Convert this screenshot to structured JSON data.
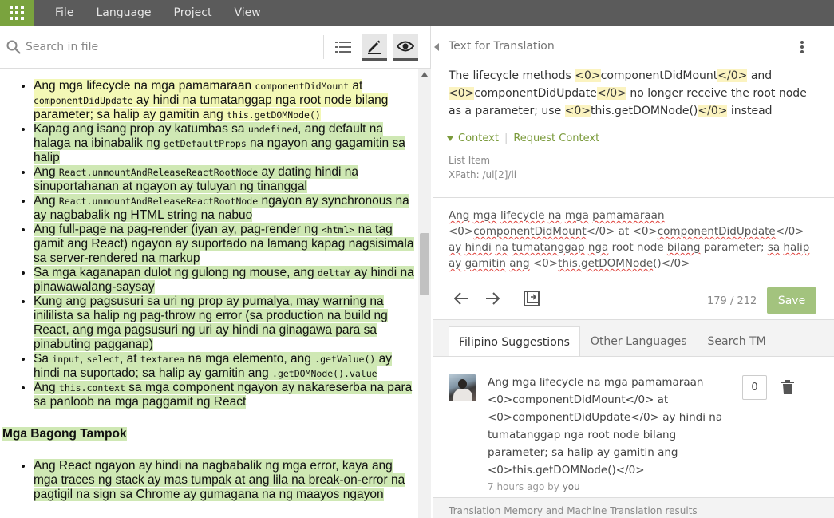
{
  "menu": [
    "File",
    "Language",
    "Project",
    "View"
  ],
  "search": {
    "placeholder": "Search in file"
  },
  "doc": {
    "items": [
      {
        "parts": [
          [
            "t",
            "Ang mga lifecycle na mga pamamaraan "
          ],
          [
            "c",
            "componentDidMount"
          ],
          [
            "t",
            " at "
          ],
          [
            "c",
            "componentDidUpdate"
          ],
          [
            "t",
            " ay hindi na tumatanggap nga root node bilang parameter; sa halip ay gamitin ang "
          ],
          [
            "c",
            "this.getDOMNode()"
          ]
        ],
        "active": true
      },
      {
        "parts": [
          [
            "t",
            "Kapag ang isang prop ay katumbas sa "
          ],
          [
            "c",
            "undefined"
          ],
          [
            "t",
            ", ang default na halaga na ibinabalik ng "
          ],
          [
            "c",
            "getDefaultProps"
          ],
          [
            "t",
            " na ngayon ang gagamitin sa halip"
          ]
        ]
      },
      {
        "parts": [
          [
            "t",
            "Ang "
          ],
          [
            "c",
            "React.unmountAndReleaseReactRootNode"
          ],
          [
            "t",
            " ay dating hindi na sinuportahanan at ngayon ay tuluyan ng tinanggal"
          ]
        ]
      },
      {
        "parts": [
          [
            "t",
            "Ang "
          ],
          [
            "c",
            "React.unmountAndReleaseReactRootNode"
          ],
          [
            "t",
            " ngayon ay synchronous na ay nagbabalik ng HTML string na nabuo"
          ]
        ]
      },
      {
        "parts": [
          [
            "t",
            "Ang full-page na pag-render (iyan ay, pag-render ng "
          ],
          [
            "c",
            "<html>"
          ],
          [
            "t",
            " na tag gamit ang React) ngayon ay suportado na lamang kapag nagsisimala sa server-rendered na markup"
          ]
        ]
      },
      {
        "parts": [
          [
            "t",
            "Sa mga kaganapan dulot ng gulong ng mouse, ang "
          ],
          [
            "c",
            "deltaY"
          ],
          [
            "t",
            " ay hindi na pinawawalang-saysay"
          ]
        ]
      },
      {
        "parts": [
          [
            "t",
            "Kung ang pagsusuri sa uri ng prop ay pumalya, may warning na inililista sa halip ng pag-throw ng error (sa production na build ng React, ang mga pagsusuri ng uri ay hindi na ginagawa para sa pinabuting pagganap)"
          ]
        ]
      },
      {
        "parts": [
          [
            "t",
            "Sa "
          ],
          [
            "c",
            "input"
          ],
          [
            "t",
            ", "
          ],
          [
            "c",
            "select"
          ],
          [
            "t",
            ", at "
          ],
          [
            "c",
            "textarea"
          ],
          [
            "t",
            " na mga elemento, ang "
          ],
          [
            "c",
            ".getValue()"
          ],
          [
            "t",
            " ay hindi na suportado; sa halip ay gamitin ang "
          ],
          [
            "c",
            ".getDOMNode().value"
          ]
        ]
      },
      {
        "parts": [
          [
            "t",
            "Ang "
          ],
          [
            "c",
            "this.context"
          ],
          [
            "t",
            " sa mga component ngayon ay nakareserba na para sa panloob na mga paggamit ng React"
          ]
        ]
      }
    ],
    "heading": "Mga Bagong Tampok",
    "items2": [
      {
        "parts": [
          [
            "t",
            "Ang React ngayon ay hindi na nagbabalik ng mga error, kaya ang mga traces ng stack ay mas tumpak at ang lila na break-on-error na pagtigil na sign sa Chrome ay gumagana na ng maayos ngayon"
          ]
        ]
      }
    ]
  },
  "source": {
    "header": "Text for Translation",
    "parts": [
      [
        "t",
        "The lifecycle methods "
      ],
      [
        "g",
        "<0>"
      ],
      [
        "t",
        "componentDidMount"
      ],
      [
        "g",
        "</0>"
      ],
      [
        "t",
        " and "
      ],
      [
        "g",
        "<0>"
      ],
      [
        "t",
        "componentDidUpdate"
      ],
      [
        "g",
        "</0>"
      ],
      [
        "t",
        " no longer receive the root node as a parameter; use "
      ],
      [
        "g",
        "<0>"
      ],
      [
        "t",
        "this.getDOMNode()"
      ],
      [
        "g",
        "</0>"
      ],
      [
        "t",
        " instead"
      ]
    ]
  },
  "context": {
    "toggle": "Context",
    "request": "Request Context",
    "type": "List Item",
    "xpath": "XPath: /ul[2]/li"
  },
  "editor": {
    "parts": [
      [
        "u",
        "Ang"
      ],
      [
        "t",
        " "
      ],
      [
        "u",
        "mga"
      ],
      [
        "t",
        " "
      ],
      [
        "u",
        "lifecycle"
      ],
      [
        "t",
        " "
      ],
      [
        "u",
        "na"
      ],
      [
        "t",
        " "
      ],
      [
        "u",
        "mga"
      ],
      [
        "t",
        " "
      ],
      [
        "u",
        "pamamaraan"
      ],
      [
        "t",
        " <0>"
      ],
      [
        "u",
        "componentDidMount"
      ],
      [
        "t",
        "</0> at <0>"
      ],
      [
        "u",
        "componentDidUpdate"
      ],
      [
        "t",
        "</0> "
      ],
      [
        "u",
        "ay"
      ],
      [
        "t",
        " "
      ],
      [
        "u",
        "hindi"
      ],
      [
        "t",
        " "
      ],
      [
        "u",
        "na"
      ],
      [
        "t",
        " "
      ],
      [
        "u",
        "tumatanggap"
      ],
      [
        "t",
        " "
      ],
      [
        "u",
        "nga"
      ],
      [
        "t",
        " root node "
      ],
      [
        "u",
        "bilang"
      ],
      [
        "t",
        " parameter; "
      ],
      [
        "u",
        "sa"
      ],
      [
        "t",
        " "
      ],
      [
        "u",
        "halip"
      ],
      [
        "t",
        " "
      ],
      [
        "u",
        "ay"
      ],
      [
        "t",
        " "
      ],
      [
        "u",
        "gamitin"
      ],
      [
        "t",
        " "
      ],
      [
        "u",
        "ang"
      ],
      [
        "t",
        " <0>"
      ],
      [
        "u",
        "this.getDOMNode"
      ],
      [
        "t",
        "()</0>"
      ]
    ]
  },
  "nav": {
    "counter": "179 / 212",
    "save": "Save"
  },
  "tabs": [
    "Filipino Suggestions",
    "Other Languages",
    "Search TM"
  ],
  "suggestion": {
    "text": "Ang mga lifecycle na mga pamamaraan <0>componentDidMount</0> at <0>componentDidUpdate</0> ay hindi na tumatanggap nga root node bilang parameter; sa halip ay gamitin ang <0>this.getDOMNode()</0>",
    "time": "7 hours ago",
    "by": " by ",
    "author": "you",
    "votes": "0"
  },
  "footer_tease": "Translation Memory and Machine Translation results",
  "colors": {
    "accent": "#7aa33e",
    "highlight": "#cfe8b4",
    "tag": "#fbf3c0",
    "save": "#a3c37e"
  }
}
